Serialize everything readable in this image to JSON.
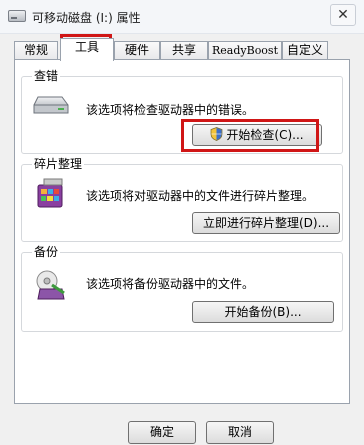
{
  "window": {
    "title": "可移动磁盘 (I:) 属性",
    "close_glyph": "✕"
  },
  "tabs": [
    {
      "label": "常规",
      "active": false
    },
    {
      "label": "工具",
      "active": true
    },
    {
      "label": "硬件",
      "active": false
    },
    {
      "label": "共享",
      "active": false
    },
    {
      "label": "ReadyBoost",
      "active": false
    },
    {
      "label": "自定义",
      "active": false
    }
  ],
  "groups": {
    "check": {
      "title": "查错",
      "description": "该选项将检查驱动器中的错误。",
      "button": "开始检查(C)...",
      "icon": "drive-icon"
    },
    "defrag": {
      "title": "碎片整理",
      "description": "该选项将对驱动器中的文件进行碎片整理。",
      "button": "立即进行碎片整理(D)...",
      "icon": "defrag-icon"
    },
    "backup": {
      "title": "备份",
      "description": "该选项将备份驱动器中的文件。",
      "button": "开始备份(B)...",
      "icon": "backup-icon"
    }
  },
  "footer": {
    "ok": "确定",
    "cancel": "取消"
  },
  "colors": {
    "highlight": "#d01616",
    "panel_bg": "#ffffff",
    "dialog_bg": "#f0f0f0"
  }
}
